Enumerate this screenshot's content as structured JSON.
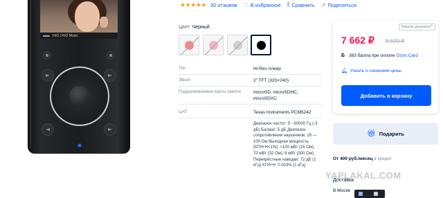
{
  "player": {
    "screen_caption": "FiiO | FiiO Music",
    "colors": {
      "body": "#1c1e21",
      "wheel_ring": "#cfd2d6",
      "led": "#2f6cff"
    }
  },
  "rating": {
    "stars": "★★★★★",
    "reviews": "30 отзывов",
    "favorite": "В избранное",
    "compare": "Сравнить",
    "share": "Поделиться"
  },
  "color_selector": {
    "label": "Цвет:",
    "value": "Черный",
    "swatches": [
      {
        "name": "Красный",
        "color": "#f28a8a",
        "available": false
      },
      {
        "name": "Розовый",
        "color": "#f5b3c6",
        "available": false
      },
      {
        "name": "Серебристый",
        "color": "#d0d0d0",
        "available": false
      },
      {
        "name": "Черный",
        "color": "#000000",
        "available": true,
        "selected": true
      }
    ]
  },
  "specs": [
    {
      "key": "Тип",
      "value": "Hi-Res плеер"
    },
    {
      "key": "Экран",
      "value": "2\" TFT (320×240)"
    },
    {
      "key": "Поддерживаемые карты памяти",
      "value": "microSD, microSDHC, microSDXC"
    },
    {
      "key": "ЦАП",
      "value": "Texas Instruments PCM5242"
    },
    {
      "key": "",
      "value": "Диапазон частот: 5 - 60000 Гц (-3 дБ) Баланс: 5 дБ Диапазон сопротивления наушников: 16 — 100 Ом Выходная мощность (КГИ+Н<1%): >100 мВт (16 Ом), 70 мВт (32 Ом), 8 мВт (300 Ом) Перекрёстные наводки: 72 дБ (1 кГц) КГИ+Н: 0.003% (1 кГц)"
    }
  ],
  "price_card": {
    "cheaper": "Нашли дешевле?",
    "price": "7 662 ₽",
    "old_price": "8 690 ₽",
    "bonus_badge": "Б",
    "bonus_text": "383 балла при оплате",
    "bonus_link": "Ozon.Card",
    "notify": "Узнать о снижении цены",
    "cart_button": "Добавить в корзину"
  },
  "gift_button": "Подарить",
  "credit": {
    "prefix": "От",
    "amount": "409 руб./месяц",
    "suffix": "в кредит"
  },
  "delivery": {
    "title": "Доставка",
    "city": "В Москв"
  },
  "watermark": "YAPLAKAL.COM"
}
